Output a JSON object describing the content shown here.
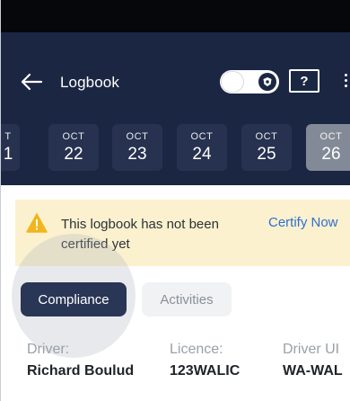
{
  "header": {
    "back_icon": "arrow-left-icon",
    "title": "Logbook",
    "toggle_icon": "shield-icon",
    "help_label": "?",
    "more_icon": "more-vertical-icon"
  },
  "date_strip": {
    "items": [
      {
        "month": "T",
        "day": "1",
        "selected": false
      },
      {
        "month": "OCT",
        "day": "22",
        "selected": false
      },
      {
        "month": "OCT",
        "day": "23",
        "selected": false
      },
      {
        "month": "OCT",
        "day": "24",
        "selected": false
      },
      {
        "month": "OCT",
        "day": "25",
        "selected": false
      },
      {
        "month": "OCT",
        "day": "26",
        "selected": true
      }
    ]
  },
  "banner": {
    "icon": "warning-icon",
    "message": "This logbook has not been certified yet",
    "action_label": "Certify Now"
  },
  "tabs": [
    {
      "label": "Compliance",
      "active": true
    },
    {
      "label": "Activities",
      "active": false
    }
  ],
  "driver_info": {
    "driver_label": "Driver:",
    "driver_value": "Richard Boulud",
    "licence_label": "Licence:",
    "licence_value": "123WALIC",
    "driver_id_label": "Driver UI",
    "driver_id_value": "WA-WAL"
  },
  "colors": {
    "header_bg": "#1b2742",
    "date_item_bg": "#26324f",
    "date_selected_bg": "#838a97",
    "banner_bg": "#fbf1cf",
    "warning": "#f2b51d",
    "link": "#2f6fd1",
    "tab_active_bg": "#2a3655"
  }
}
